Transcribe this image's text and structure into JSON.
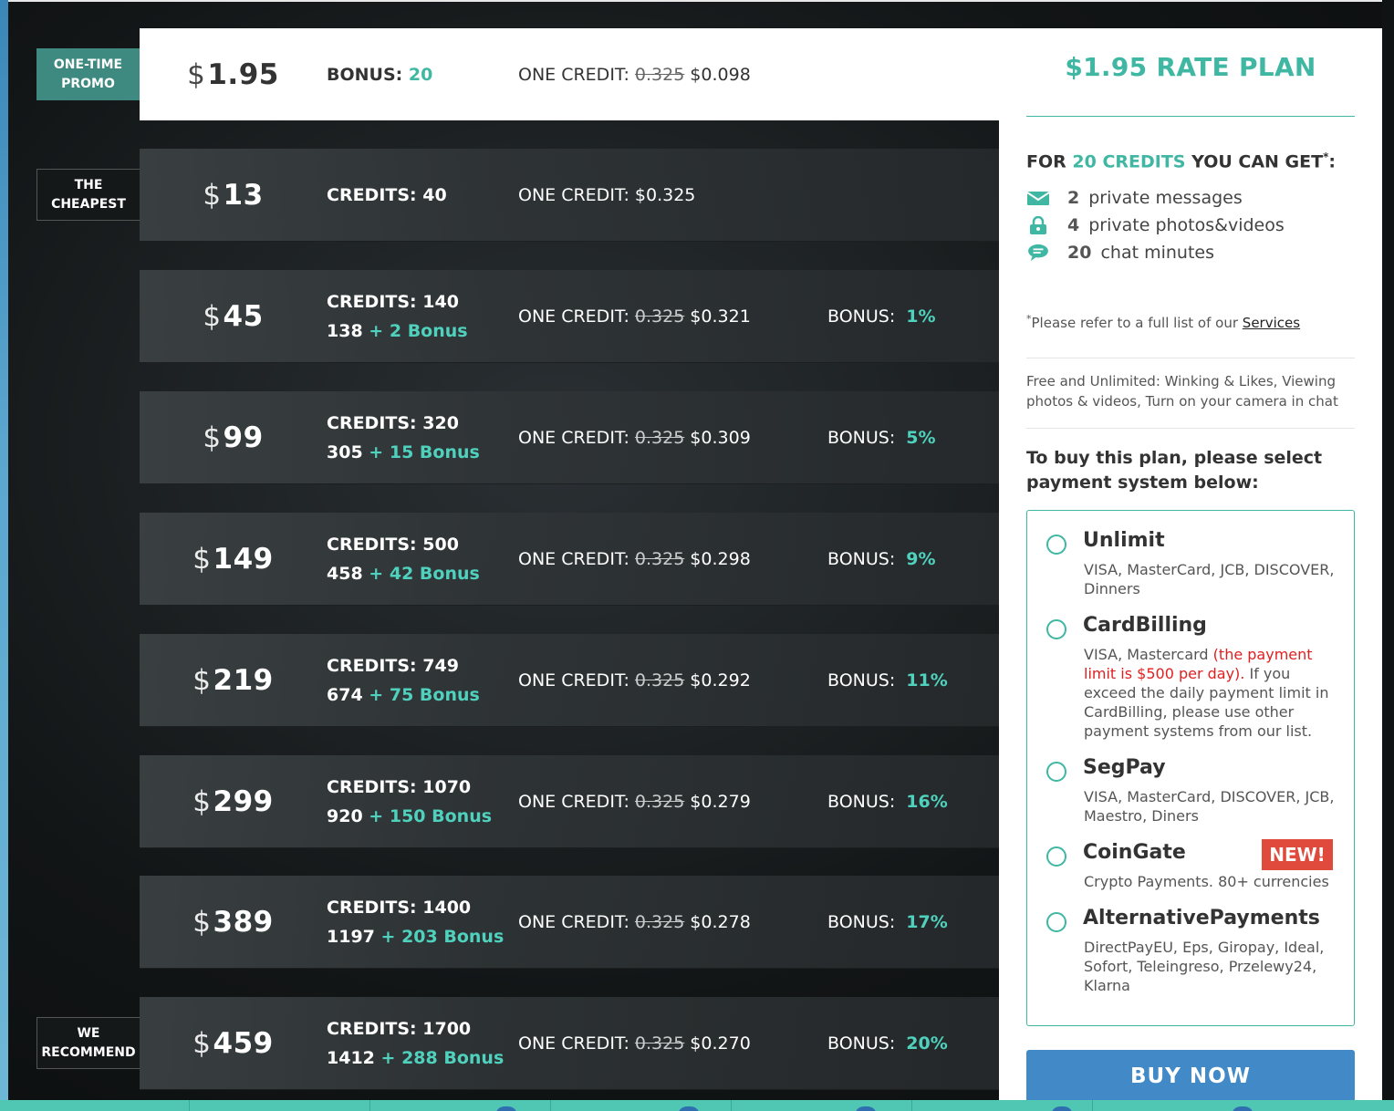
{
  "colors": {
    "teal": "#3fb7a3",
    "teal_bright": "#4fd1bd",
    "promo_tag": "#3e8a80",
    "buy_button": "#4189c7",
    "new_badge": "#e04a3c",
    "warning_red": "#e02020"
  },
  "tags": {
    "promo": [
      "ONE-TIME",
      "PROMO"
    ],
    "cheapest": [
      "THE",
      "CHEAPEST"
    ],
    "recommend": [
      "WE",
      "RECOMMEND"
    ]
  },
  "labels": {
    "currency": "$",
    "bonus_label": "BONUS:",
    "credits_label": "CREDITS:",
    "one_credit_label": "ONE CREDIT:",
    "bonus_word": "Bonus",
    "plus": "+"
  },
  "promo_row": {
    "price": "1.95",
    "bonus_value": "20",
    "old_rate": "0.325",
    "rate": "$0.098"
  },
  "rows": [
    {
      "price": "13",
      "credits": "40",
      "base": "",
      "extra": "",
      "old_rate": "",
      "rate": "$0.325",
      "bonus_pct": ""
    },
    {
      "price": "45",
      "credits": "140",
      "base": "138",
      "extra": "2",
      "old_rate": "0.325",
      "rate": "$0.321",
      "bonus_pct": "1%"
    },
    {
      "price": "99",
      "credits": "320",
      "base": "305",
      "extra": "15",
      "old_rate": "0.325",
      "rate": "$0.309",
      "bonus_pct": "5%"
    },
    {
      "price": "149",
      "credits": "500",
      "base": "458",
      "extra": "42",
      "old_rate": "0.325",
      "rate": "$0.298",
      "bonus_pct": "9%"
    },
    {
      "price": "219",
      "credits": "749",
      "base": "674",
      "extra": "75",
      "old_rate": "0.325",
      "rate": "$0.292",
      "bonus_pct": "11%"
    },
    {
      "price": "299",
      "credits": "1070",
      "base": "920",
      "extra": "150",
      "old_rate": "0.325",
      "rate": "$0.279",
      "bonus_pct": "16%"
    },
    {
      "price": "389",
      "credits": "1400",
      "base": "1197",
      "extra": "203",
      "old_rate": "0.325",
      "rate": "$0.278",
      "bonus_pct": "17%"
    },
    {
      "price": "459",
      "credits": "1700",
      "base": "1412",
      "extra": "288",
      "old_rate": "0.325",
      "rate": "$0.270",
      "bonus_pct": "20%"
    }
  ],
  "panel": {
    "title": "$1.95 RATE PLAN",
    "for_prefix": "FOR",
    "for_credits": "20 CREDITS",
    "for_suffix": "YOU CAN GET",
    "for_star": "*",
    "for_colon": ":",
    "benefits": [
      {
        "icon": "envelope-icon",
        "count": "2",
        "label": "private messages"
      },
      {
        "icon": "lock-icon",
        "count": "4",
        "label": "private photos&videos"
      },
      {
        "icon": "chat-bubble-icon",
        "count": "20",
        "label": "chat minutes"
      }
    ],
    "note_star": "*",
    "note_text": "Please refer to a full list of our",
    "note_link": "Services",
    "free_text": "Free and Unlimited: Winking & Likes, Viewing photos & videos, Turn on your camera in chat",
    "buy_text": "To buy this plan, please select payment system below:",
    "payments": [
      {
        "name": "Unlimit",
        "desc": "VISA, MasterCard, JCB, DISCOVER, Dinners"
      },
      {
        "name": "CardBilling",
        "desc_pre": "VISA, Mastercard",
        "desc_red": "(the payment limit is $500 per day).",
        "desc_post": "If you exceed the daily payment limit in CardBilling, please use other payment systems from our list."
      },
      {
        "name": "SegPay",
        "desc": "VISA, MasterCard, DISCOVER, JCB, Maestro, Diners"
      },
      {
        "name": "CoinGate",
        "desc": "Crypto Payments. 80+ currencies",
        "badge": "NEW!"
      },
      {
        "name": "AlternativePayments",
        "desc": "DirectPayEU, Eps, Giropay, Ideal, Sofort, Teleingreso, Przelewy24, Klarna"
      }
    ],
    "buy_button": "BUY NOW"
  }
}
